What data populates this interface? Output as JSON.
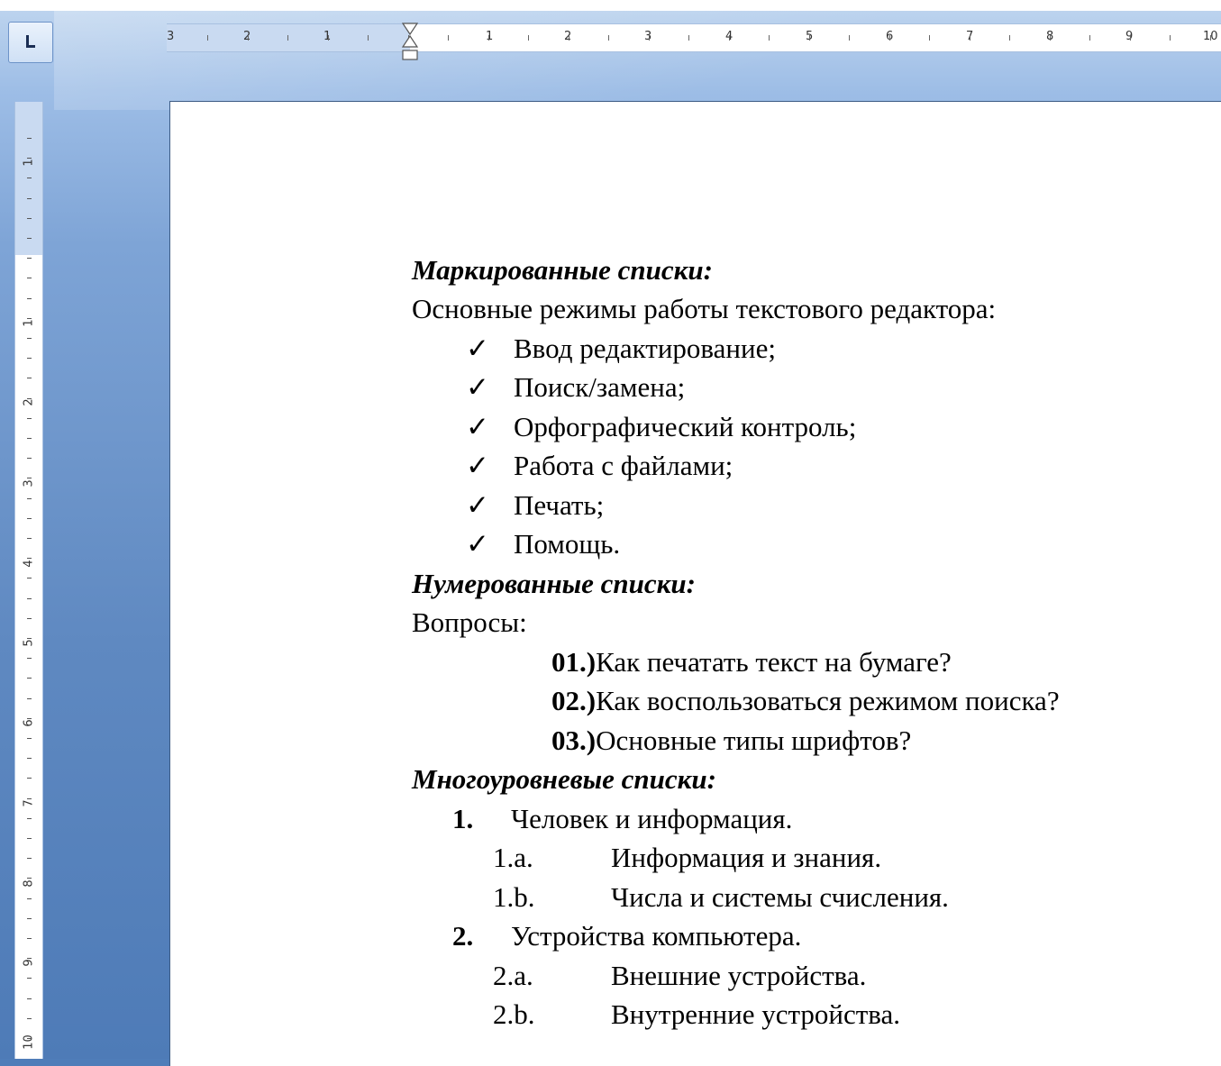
{
  "ruler": {
    "horizontal_ticks": [
      "3",
      "2",
      "1",
      "1",
      "2",
      "3",
      "4",
      "5",
      "6",
      "7",
      "8",
      "9",
      "10"
    ],
    "vertical_ticks": [
      "1",
      "1",
      "2",
      "3",
      "4",
      "5",
      "6",
      "7",
      "8",
      "9",
      "10"
    ]
  },
  "document": {
    "bulleted": {
      "heading": "Маркированные списки:",
      "intro": "Основные режимы работы текстового редактора:",
      "bullet_symbol": "✓",
      "items": [
        "Ввод редактирование;",
        "Поиск/замена;",
        "Орфографический контроль;",
        "Работа с файлами;",
        "Печать;",
        "Помощь."
      ]
    },
    "numbered": {
      "heading": "Нумерованные списки:",
      "intro": "Вопросы:",
      "items": [
        {
          "num": "01.)",
          "text": "Как печатать текст на бумаге?"
        },
        {
          "num": "02.)",
          "text": "Как воспользоваться режимом поиска?"
        },
        {
          "num": "03.)",
          "text": "Основные типы шрифтов?"
        }
      ]
    },
    "multilevel": {
      "heading": "Многоуровневые списки:",
      "items": [
        {
          "num": "1.",
          "text": "Человек и информация.",
          "sub": [
            {
              "num": "1.a.",
              "text": "Информация и знания."
            },
            {
              "num": "1.b.",
              "text": "Числа и системы счисления."
            }
          ]
        },
        {
          "num": "2.",
          "text": "Устройства компьютера.",
          "sub": [
            {
              "num": "2.a.",
              "text": "Внешние устройства."
            },
            {
              "num": "2.b.",
              "text": "Внутренние устройства."
            }
          ]
        }
      ]
    }
  }
}
